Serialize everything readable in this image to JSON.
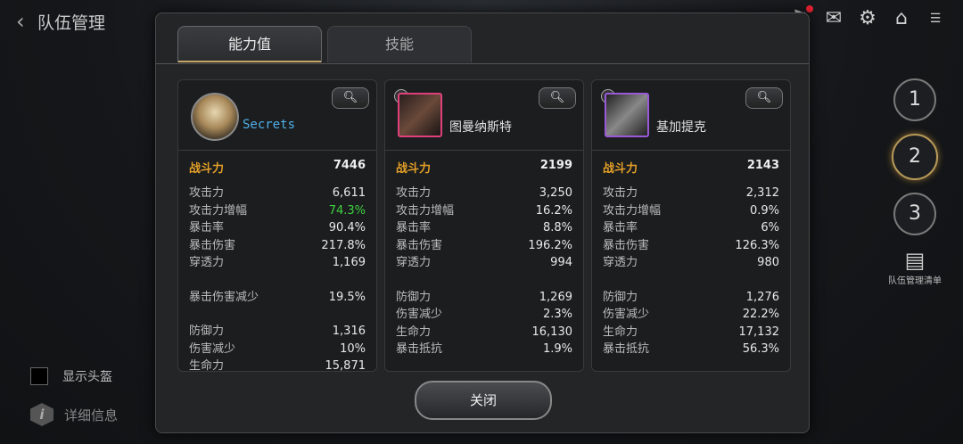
{
  "header": {
    "back": "‹",
    "title": "队伍管理"
  },
  "top_icons": [
    "bell-icon",
    "chat-icon",
    "gear-icon",
    "home-icon",
    "wifi-battery-icon"
  ],
  "sidebar": {
    "slots": [
      "1",
      "2",
      "3"
    ],
    "active_slot": "2",
    "roster_label": "队伍管理清单"
  },
  "options": {
    "show_helmet": "显示头盔",
    "details": "详细信息"
  },
  "modal": {
    "tabs": [
      "能力值",
      "技能"
    ],
    "active_tab": "能力值",
    "close_label": "关闭",
    "zoom_icon": "magnifier-icon",
    "cards": [
      {
        "name": "Secrets",
        "power_label": "战斗力",
        "power": "7446",
        "groups": [
          [
            {
              "label": "攻击力",
              "value": "6,611"
            },
            {
              "label": "攻击力增幅",
              "value": "74.3%",
              "highlight": true
            },
            {
              "label": "暴击率",
              "value": "90.4%"
            },
            {
              "label": "暴击伤害",
              "value": "217.8%"
            },
            {
              "label": "穿透力",
              "value": "1,169"
            }
          ],
          [
            {
              "label": "暴击伤害减少",
              "value": "19.5%"
            }
          ],
          [
            {
              "label": "防御力",
              "value": "1,316"
            },
            {
              "label": "伤害减少",
              "value": "10%"
            },
            {
              "label": "生命力",
              "value": "15,871"
            }
          ]
        ]
      },
      {
        "name": "图曼纳斯特",
        "power_label": "战斗力",
        "power": "2199",
        "groups": [
          [
            {
              "label": "攻击力",
              "value": "3,250"
            },
            {
              "label": "攻击力增幅",
              "value": "16.2%"
            },
            {
              "label": "暴击率",
              "value": "8.8%"
            },
            {
              "label": "暴击伤害",
              "value": "196.2%"
            },
            {
              "label": "穿透力",
              "value": "994"
            }
          ],
          [
            {
              "label": "防御力",
              "value": "1,269"
            },
            {
              "label": "伤害减少",
              "value": "2.3%"
            },
            {
              "label": "生命力",
              "value": "16,130"
            },
            {
              "label": "暴击抵抗",
              "value": "1.9%"
            }
          ]
        ]
      },
      {
        "name": "基加提克",
        "power_label": "战斗力",
        "power": "2143",
        "groups": [
          [
            {
              "label": "攻击力",
              "value": "2,312"
            },
            {
              "label": "攻击力增幅",
              "value": "0.9%"
            },
            {
              "label": "暴击率",
              "value": "6%"
            },
            {
              "label": "暴击伤害",
              "value": "126.3%"
            },
            {
              "label": "穿透力",
              "value": "980"
            }
          ],
          [
            {
              "label": "防御力",
              "value": "1,276"
            },
            {
              "label": "伤害减少",
              "value": "22.2%"
            },
            {
              "label": "生命力",
              "value": "17,132"
            },
            {
              "label": "暴击抵抗",
              "value": "56.3%"
            }
          ]
        ]
      }
    ]
  }
}
